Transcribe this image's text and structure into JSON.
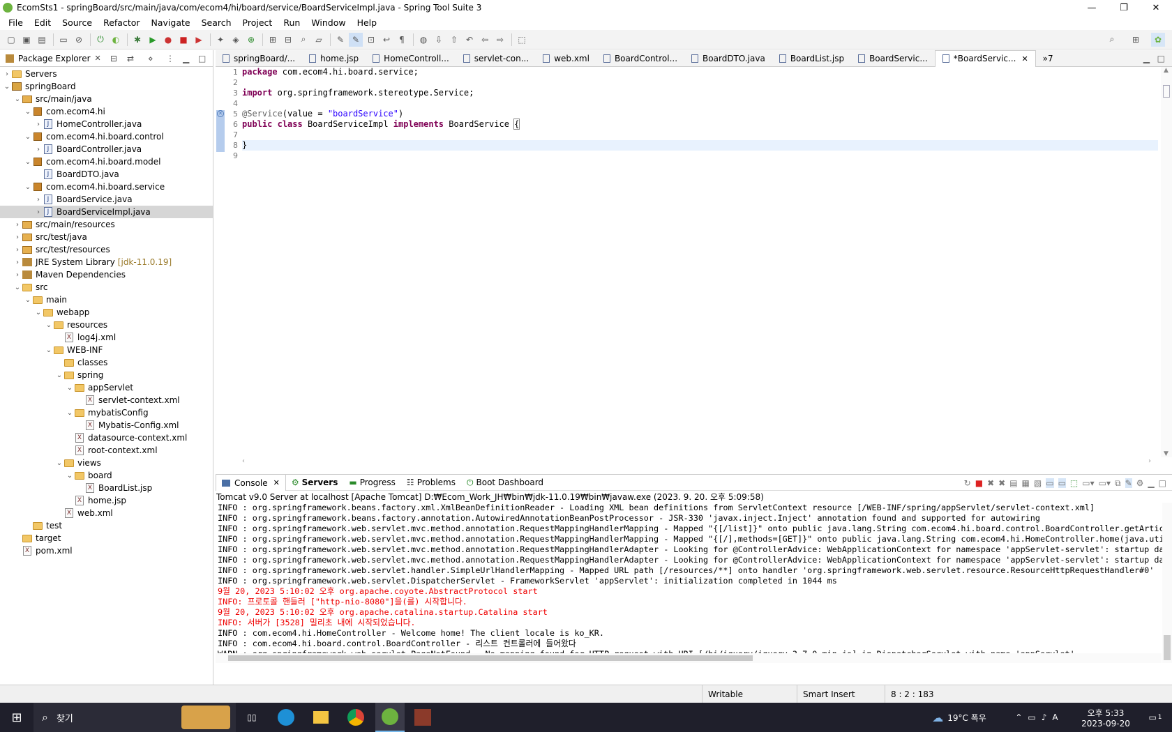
{
  "window": {
    "title": "EcomSts1 - springBoard/src/main/java/com/ecom4/hi/board/service/BoardServiceImpl.java - Spring Tool Suite 3",
    "minimize": "—",
    "maximize": "❐",
    "close": "✕"
  },
  "menu": [
    "File",
    "Edit",
    "Source",
    "Refactor",
    "Navigate",
    "Search",
    "Project",
    "Run",
    "Window",
    "Help"
  ],
  "package_explorer": {
    "title": "Package Explorer",
    "close": "✕",
    "tree": [
      {
        "label": "Servers",
        "indent": 0,
        "twisty": "›",
        "icon": "fold"
      },
      {
        "label": "springBoard",
        "indent": 0,
        "twisty": "⌄",
        "icon": "proj"
      },
      {
        "label": "src/main/java",
        "indent": 1,
        "twisty": "⌄",
        "icon": "srcf"
      },
      {
        "label": "com.ecom4.hi",
        "indent": 2,
        "twisty": "⌄",
        "icon": "pkg"
      },
      {
        "label": "HomeController.java",
        "indent": 3,
        "twisty": "›",
        "icon": "jfile"
      },
      {
        "label": "com.ecom4.hi.board.control",
        "indent": 2,
        "twisty": "⌄",
        "icon": "pkg"
      },
      {
        "label": "BoardController.java",
        "indent": 3,
        "twisty": "›",
        "icon": "jfile"
      },
      {
        "label": "com.ecom4.hi.board.model",
        "indent": 2,
        "twisty": "⌄",
        "icon": "pkg"
      },
      {
        "label": "BoardDTO.java",
        "indent": 3,
        "twisty": "",
        "icon": "jfile"
      },
      {
        "label": "com.ecom4.hi.board.service",
        "indent": 2,
        "twisty": "⌄",
        "icon": "pkg"
      },
      {
        "label": "BoardService.java",
        "indent": 3,
        "twisty": "›",
        "icon": "jfile"
      },
      {
        "label": "BoardServiceImpl.java",
        "indent": 3,
        "twisty": "›",
        "icon": "jfile",
        "selected": true
      },
      {
        "label": "src/main/resources",
        "indent": 1,
        "twisty": "›",
        "icon": "srcf"
      },
      {
        "label": "src/test/java",
        "indent": 1,
        "twisty": "›",
        "icon": "srcf"
      },
      {
        "label": "src/test/resources",
        "indent": 1,
        "twisty": "›",
        "icon": "srcf"
      },
      {
        "label": "JRE System Library",
        "suffix": "[jdk-11.0.19]",
        "indent": 1,
        "twisty": "›",
        "icon": "lib"
      },
      {
        "label": "Maven Dependencies",
        "indent": 1,
        "twisty": "›",
        "icon": "lib"
      },
      {
        "label": "src",
        "indent": 1,
        "twisty": "⌄",
        "icon": "fold"
      },
      {
        "label": "main",
        "indent": 2,
        "twisty": "⌄",
        "icon": "fold"
      },
      {
        "label": "webapp",
        "indent": 3,
        "twisty": "⌄",
        "icon": "fold"
      },
      {
        "label": "resources",
        "indent": 4,
        "twisty": "⌄",
        "icon": "fold"
      },
      {
        "label": "log4j.xml",
        "indent": 5,
        "twisty": "",
        "icon": "xfile"
      },
      {
        "label": "WEB-INF",
        "indent": 4,
        "twisty": "⌄",
        "icon": "fold"
      },
      {
        "label": "classes",
        "indent": 5,
        "twisty": "",
        "icon": "fold"
      },
      {
        "label": "spring",
        "indent": 5,
        "twisty": "⌄",
        "icon": "fold"
      },
      {
        "label": "appServlet",
        "indent": 6,
        "twisty": "⌄",
        "icon": "fold"
      },
      {
        "label": "servlet-context.xml",
        "indent": 7,
        "twisty": "",
        "icon": "xfile"
      },
      {
        "label": "mybatisConfig",
        "indent": 6,
        "twisty": "⌄",
        "icon": "fold"
      },
      {
        "label": "Mybatis-Config.xml",
        "indent": 7,
        "twisty": "",
        "icon": "xfile"
      },
      {
        "label": "datasource-context.xml",
        "indent": 6,
        "twisty": "",
        "icon": "xfile"
      },
      {
        "label": "root-context.xml",
        "indent": 6,
        "twisty": "",
        "icon": "xfile"
      },
      {
        "label": "views",
        "indent": 5,
        "twisty": "⌄",
        "icon": "fold"
      },
      {
        "label": "board",
        "indent": 6,
        "twisty": "⌄",
        "icon": "fold"
      },
      {
        "label": "BoardList.jsp",
        "indent": 7,
        "twisty": "",
        "icon": "xfile"
      },
      {
        "label": "home.jsp",
        "indent": 6,
        "twisty": "",
        "icon": "xfile"
      },
      {
        "label": "web.xml",
        "indent": 5,
        "twisty": "",
        "icon": "xfile"
      },
      {
        "label": "test",
        "indent": 2,
        "twisty": "",
        "icon": "fold"
      },
      {
        "label": "target",
        "indent": 1,
        "twisty": "",
        "icon": "fold"
      },
      {
        "label": "pom.xml",
        "indent": 1,
        "twisty": "",
        "icon": "xfile"
      }
    ]
  },
  "editor_tabs": [
    {
      "label": "springBoard/...",
      "active": false
    },
    {
      "label": "home.jsp",
      "active": false
    },
    {
      "label": "HomeControll...",
      "active": false
    },
    {
      "label": "servlet-con...",
      "active": false
    },
    {
      "label": "web.xml",
      "active": false
    },
    {
      "label": "BoardControl...",
      "active": false
    },
    {
      "label": "BoardDTO.java",
      "active": false
    },
    {
      "label": "BoardList.jsp",
      "active": false
    },
    {
      "label": "BoardServic...",
      "active": false
    },
    {
      "label": "*BoardServic...",
      "active": true
    }
  ],
  "editor_overflow": "»7",
  "code": {
    "line_numbers": [
      "1",
      "2",
      "3",
      "4",
      "5",
      "6",
      "7",
      "8",
      "9"
    ],
    "line1_kw": "package",
    "line1_rest": " com.ecom4.hi.board.service;",
    "line3_kw": "import",
    "line3_rest": " org.springframework.stereotype.Service;",
    "line5_ann": "@Service",
    "line5_mid": "(value = ",
    "line5_str": "\"boardService\"",
    "line5_end": ")",
    "line6_kw1": "public",
    "line6_kw2": "class",
    "line6_name": " BoardServiceImpl ",
    "line6_kw3": "implements",
    "line6_rest": " BoardService ",
    "line6_brace": "{",
    "line8": "}"
  },
  "console_tabs": [
    {
      "label": "Console",
      "icon": "console-icon",
      "close": "✕"
    },
    {
      "label": "Servers",
      "icon": "servers-icon"
    },
    {
      "label": "Progress",
      "icon": "progress-icon"
    },
    {
      "label": "Problems",
      "icon": "problems-icon"
    },
    {
      "label": "Boot Dashboard",
      "icon": "boot-dashboard-icon"
    }
  ],
  "console_header": "Tomcat v9.0 Server at localhost [Apache Tomcat] D:₩Ecom_Work_JH₩bin₩jdk-11.0.19₩bin₩javaw.exe  (2023. 9. 20. 오후 5:09:58)",
  "console_lines": [
    {
      "text": "INFO : org.springframework.beans.factory.xml.XmlBeanDefinitionReader - Loading XML bean definitions from ServletContext resource [/WEB-INF/spring/appServlet/servlet-context.xml]",
      "red": false
    },
    {
      "text": "INFO : org.springframework.beans.factory.annotation.AutowiredAnnotationBeanPostProcessor - JSR-330 'javax.inject.Inject' annotation found and supported for autowiring",
      "red": false
    },
    {
      "text": "INFO : org.springframework.web.servlet.mvc.method.annotation.RequestMappingHandlerMapping - Mapped \"{[/list]}\" onto public java.lang.String com.ecom4.hi.board.control.BoardController.getArticle",
      "red": false
    },
    {
      "text": "INFO : org.springframework.web.servlet.mvc.method.annotation.RequestMappingHandlerMapping - Mapped \"{[/],methods=[GET]}\" onto public java.lang.String com.ecom4.hi.HomeController.home(java.util.",
      "red": false
    },
    {
      "text": "INFO : org.springframework.web.servlet.mvc.method.annotation.RequestMappingHandlerAdapter - Looking for @ControllerAdvice: WebApplicationContext for namespace 'appServlet-servlet': startup date",
      "red": false
    },
    {
      "text": "INFO : org.springframework.web.servlet.mvc.method.annotation.RequestMappingHandlerAdapter - Looking for @ControllerAdvice: WebApplicationContext for namespace 'appServlet-servlet': startup date",
      "red": false
    },
    {
      "text": "INFO : org.springframework.web.servlet.handler.SimpleUrlHandlerMapping - Mapped URL path [/resources/**] onto handler 'org.springframework.web.servlet.resource.ResourceHttpRequestHandler#0'",
      "red": false
    },
    {
      "text": "INFO : org.springframework.web.servlet.DispatcherServlet - FrameworkServlet 'appServlet': initialization completed in 1044 ms",
      "red": false
    },
    {
      "text": "9월 20, 2023 5:10:02 오후 org.apache.coyote.AbstractProtocol start",
      "red": true
    },
    {
      "text": "INFO: 프로토콜 핸들러 [\"http-nio-8080\"]을(를) 시작합니다.",
      "red": true
    },
    {
      "text": "9월 20, 2023 5:10:02 오후 org.apache.catalina.startup.Catalina start",
      "red": true
    },
    {
      "text": "INFO: 서버가 [3528] 밀리초 내에 시작되었습니다.",
      "red": true
    },
    {
      "text": "INFO : com.ecom4.hi.HomeController - Welcome home! The client locale is ko_KR.",
      "red": false
    },
    {
      "text": "INFO : com.ecom4.hi.board.control.BoardController - 리스트 컨트롤러에 들어왔다",
      "red": false
    },
    {
      "text": "WARN : org.springframework.web.servlet.PageNotFound - No mapping found for HTTP request with URI [/hi/jquery/jquery-3.7.0.min.js] in DispatcherServlet with name 'appServlet'",
      "red": false
    }
  ],
  "status": {
    "writable": "Writable",
    "insert": "Smart Insert",
    "position": "8 : 2 : 183"
  },
  "taskbar": {
    "search": "찾기",
    "weather": "19°C  폭우",
    "time": "오후 5:33",
    "date": "2023-09-20",
    "ime": "A",
    "notifications": "1"
  }
}
